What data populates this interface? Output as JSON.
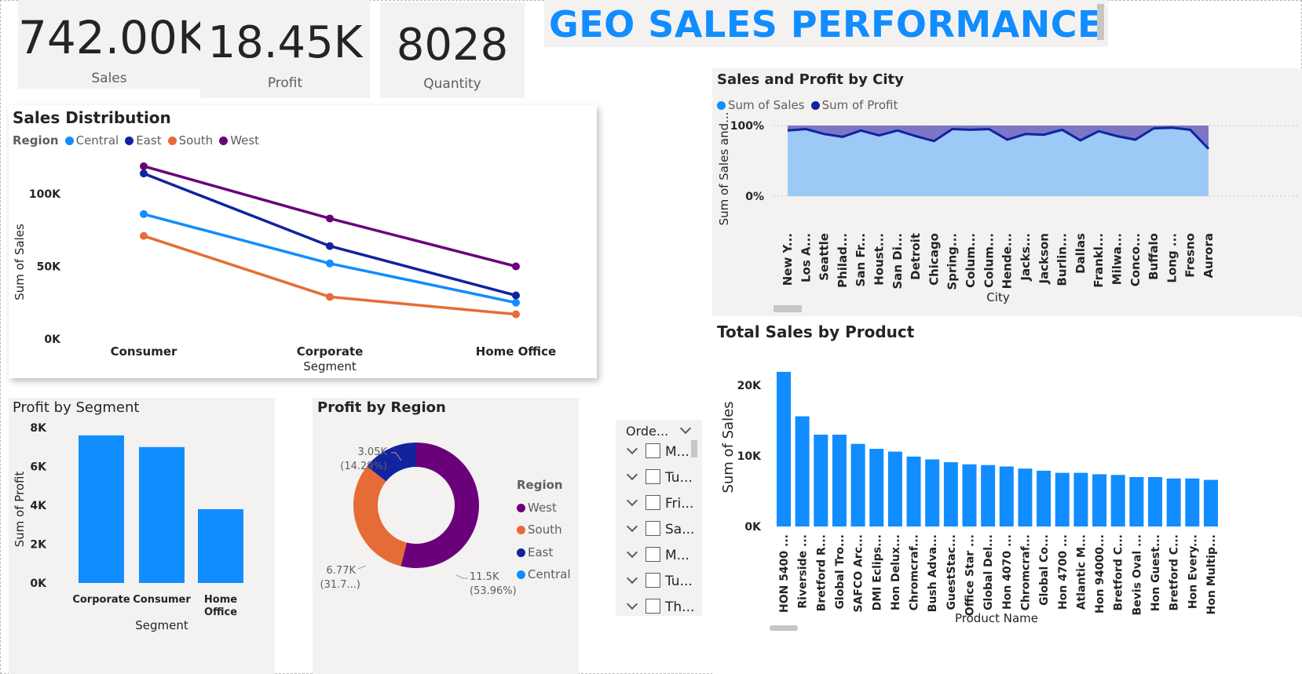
{
  "kpis": [
    {
      "value": "742.00K",
      "label": "Sales"
    },
    {
      "value": "18.45K",
      "label": "Profit"
    },
    {
      "value": "8028",
      "label": "Quantity"
    }
  ],
  "page_title": "GEO SALES PERFORMANCE",
  "colors": {
    "central": "#118dff",
    "east": "#12239e",
    "south": "#e66c37",
    "west": "#6b007b",
    "bar": "#118dff",
    "area_light": "#9dc9f7",
    "area_dark": "#7b77c6"
  },
  "sales_distribution": {
    "title": "Sales Distribution",
    "legend_title": "Region",
    "chart_data": {
      "type": "line",
      "categories": [
        "Consumer",
        "Corporate",
        "Home Office"
      ],
      "xlabel": "Segment",
      "ylabel": "Sum of Sales",
      "yticks": [
        "0K",
        "50K",
        "100K"
      ],
      "ylim": [
        0,
        130000
      ],
      "series": [
        {
          "name": "Central",
          "values": [
            86000,
            52000,
            25000
          ]
        },
        {
          "name": "East",
          "values": [
            114000,
            64000,
            30000
          ]
        },
        {
          "name": "South",
          "values": [
            71000,
            29000,
            17000
          ]
        },
        {
          "name": "West",
          "values": [
            119000,
            83000,
            50000
          ]
        }
      ]
    }
  },
  "city_chart": {
    "title": "Sales and Profit by City",
    "chart_data": {
      "type": "area",
      "xlabel": "City",
      "ylabel": "Sum of Sales and...",
      "yticks": [
        "0%",
        "100%"
      ],
      "categories": [
        "New Y...",
        "Los A...",
        "Seattle",
        "Philad...",
        "San Fr...",
        "Houst...",
        "San Di...",
        "Detroit",
        "Chicago",
        "Spring...",
        "Colum...",
        "Colum...",
        "Hende...",
        "Jacks...",
        "Jackson",
        "Burlin...",
        "Dallas",
        "Frankl...",
        "Milwa...",
        "Conco...",
        "Buffalo",
        "Long ...",
        "Fresno",
        "Aurora"
      ],
      "series": [
        {
          "name": "Sum of Sales",
          "values": [
            0.93,
            0.95,
            0.88,
            0.84,
            0.93,
            0.86,
            0.93,
            0.85,
            0.78,
            0.95,
            0.94,
            0.95,
            0.8,
            0.88,
            0.87,
            0.94,
            0.79,
            0.92,
            0.85,
            0.8,
            0.96,
            0.97,
            0.94,
            0.67
          ]
        },
        {
          "name": "Sum of Profit",
          "values": [
            0.07,
            0.05,
            0.12,
            0.16,
            0.07,
            0.14,
            0.07,
            0.15,
            0.22,
            0.05,
            0.06,
            0.05,
            0.2,
            0.12,
            0.13,
            0.06,
            0.21,
            0.08,
            0.15,
            0.2,
            0.04,
            0.03,
            0.06,
            0.33
          ]
        }
      ]
    }
  },
  "product_chart": {
    "title": "Total Sales by Product",
    "chart_data": {
      "type": "bar",
      "xlabel": "Product Name",
      "ylabel": "Sum of Sales",
      "yticks": [
        "0K",
        "10K",
        "20K"
      ],
      "ylim": [
        0,
        22000
      ],
      "categories": [
        "HON 5400 ...",
        "Riverside ...",
        "Bretford R...",
        "Global Tro...",
        "SAFCO Arc...",
        "DMI Eclips...",
        "Hon Delux...",
        "Chromcraf...",
        "Bush Adva...",
        "GuestStac...",
        "Office Star ...",
        "Global Del...",
        "Hon 4070 ...",
        "Chromcraf...",
        "Global Co...",
        "Hon 4700 ...",
        "Atlantic M...",
        "Hon 94000...",
        "Bretford C...",
        "Bevis Oval ...",
        "Hon Guest...",
        "Bretford C...",
        "Hon Every...",
        "Hon Multip..."
      ],
      "values": [
        21900,
        15600,
        13000,
        13000,
        11700,
        11000,
        10600,
        9900,
        9500,
        9100,
        8800,
        8700,
        8500,
        8200,
        7900,
        7600,
        7600,
        7400,
        7300,
        7000,
        7000,
        6800,
        6800,
        6600
      ]
    }
  },
  "profit_segment": {
    "title": "Profit by Segment",
    "chart_data": {
      "type": "bar",
      "categories": [
        "Corporate",
        "Consumer",
        "Home Office"
      ],
      "values": [
        7600,
        7000,
        3800
      ],
      "xlabel": "Segment",
      "ylabel": "Sum of Profit",
      "yticks": [
        "0K",
        "2K",
        "4K",
        "6K",
        "8K"
      ],
      "ylim": [
        0,
        8000
      ]
    }
  },
  "profit_region": {
    "title": "Profit by Region",
    "legend_title": "Region",
    "chart_data": {
      "type": "pie",
      "slices": [
        {
          "name": "West",
          "value": 11.5,
          "label": "11.5K",
          "pct": "(53.96%)"
        },
        {
          "name": "South",
          "value": 6.77,
          "label": "6.77K",
          "pct": "(31.7...)"
        },
        {
          "name": "East",
          "value": 3.05,
          "label": "3.05K",
          "pct": "(14.29%)"
        },
        {
          "name": "Central",
          "value": 0,
          "label": "",
          "pct": ""
        }
      ]
    },
    "legend": [
      "West",
      "South",
      "East",
      "Central"
    ]
  },
  "slicer": {
    "header": "Orde...",
    "items": [
      "M...",
      "Tu...",
      "Fri...",
      "Sa...",
      "M...",
      "Tu...",
      "Th..."
    ]
  }
}
